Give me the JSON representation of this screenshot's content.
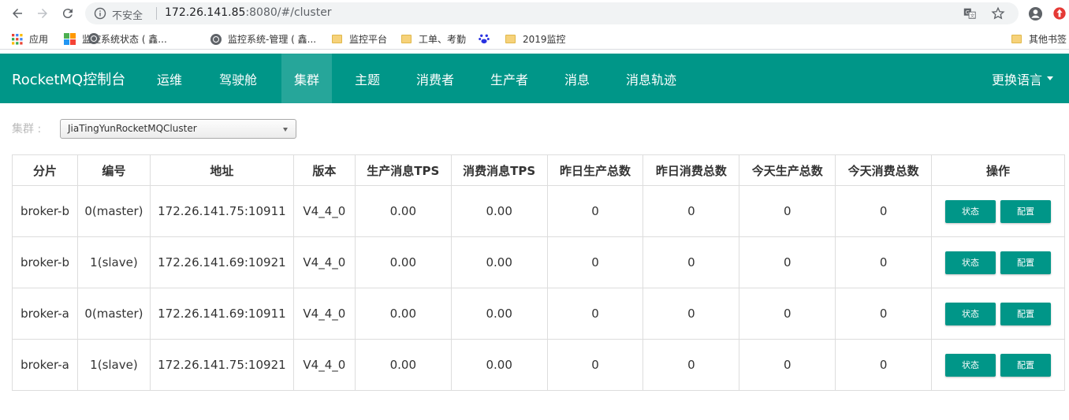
{
  "browser": {
    "insecure_label": "不安全",
    "url_host": "172.26.141.85",
    "url_rest": ":8080/#/cluster"
  },
  "bookmarks": [
    {
      "label": "应用",
      "icon": "apps-grid-icon"
    },
    {
      "label": "监控系统状态 ( 鑫...",
      "icon": "web-favicon-icon"
    },
    {
      "label": "监控系统-管理 ( 鑫...",
      "icon": "globe-icon"
    },
    {
      "label": "监控系统-管理 ( 鑫...",
      "icon": "globe-icon"
    },
    {
      "label": "监控平台",
      "icon": "folder-icon"
    },
    {
      "label": "工单、考勤",
      "icon": "folder-icon"
    },
    {
      "label": "",
      "icon": "paw-icon"
    },
    {
      "label": "2019监控",
      "icon": "folder-icon"
    },
    {
      "label": "其他书签",
      "icon": "folder-icon"
    }
  ],
  "navbar": {
    "brand": "RocketMQ控制台",
    "items": [
      "运维",
      "驾驶舱",
      "集群",
      "主题",
      "消费者",
      "生产者",
      "消息",
      "消息轨迹"
    ],
    "active": "集群",
    "language": "更换语言",
    "color": "#009688"
  },
  "cluster": {
    "label": "集群 :",
    "selected": "JiaTingYunRocketMQCluster"
  },
  "table": {
    "headers": [
      "分片",
      "编号",
      "地址",
      "版本",
      "生产消息TPS",
      "消费消息TPS",
      "昨日生产总数",
      "昨日消费总数",
      "今天生产总数",
      "今天消费总数",
      "操作"
    ],
    "status_button": "状态",
    "config_button": "配置",
    "rows": [
      [
        "broker-b",
        "0(master)",
        "172.26.141.75:10911",
        "V4_4_0",
        "0.00",
        "0.00",
        "0",
        "0",
        "0",
        "0"
      ],
      [
        "broker-b",
        "1(slave)",
        "172.26.141.69:10921",
        "V4_4_0",
        "0.00",
        "0.00",
        "0",
        "0",
        "0",
        "0"
      ],
      [
        "broker-a",
        "0(master)",
        "172.26.141.69:10911",
        "V4_4_0",
        "0.00",
        "0.00",
        "0",
        "0",
        "0",
        "0"
      ],
      [
        "broker-a",
        "1(slave)",
        "172.26.141.75:10921",
        "V4_4_0",
        "0.00",
        "0.00",
        "0",
        "0",
        "0",
        "0"
      ]
    ]
  }
}
